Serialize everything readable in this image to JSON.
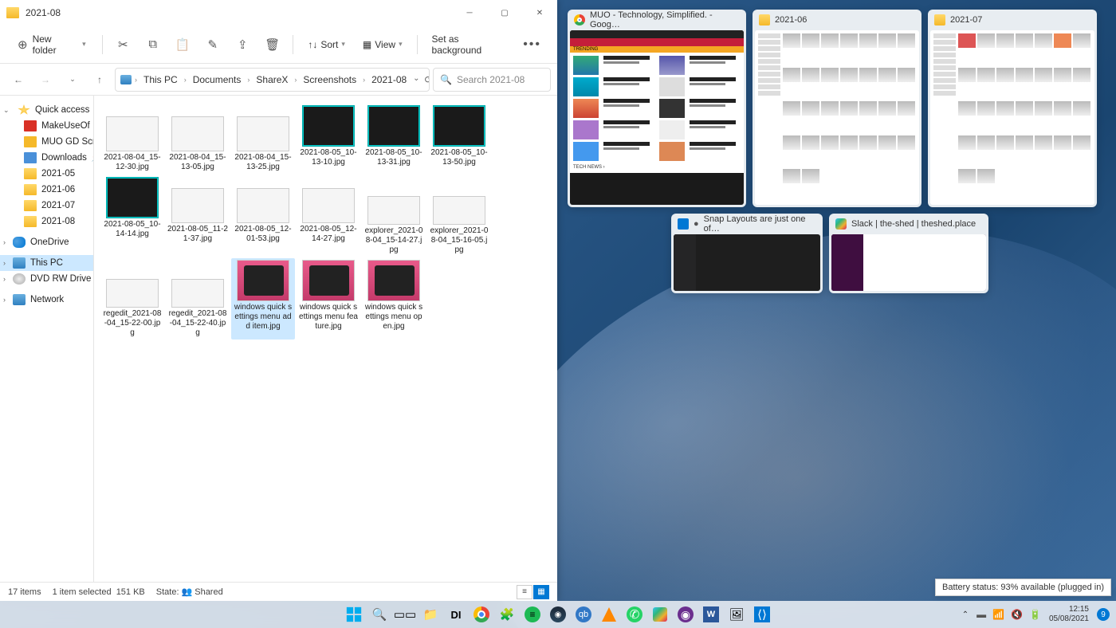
{
  "window": {
    "title": "2021-08",
    "toolbar": {
      "new_folder": "New folder",
      "sort": "Sort",
      "view": "View",
      "set_as_background": "Set as background"
    },
    "breadcrumbs": [
      "This PC",
      "Documents",
      "ShareX",
      "Screenshots",
      "2021-08"
    ],
    "search_placeholder": "Search 2021-08"
  },
  "sidebar": {
    "quick_access": "Quick access",
    "pinned": [
      {
        "label": "MakeUseOf",
        "icon": "makeuseof",
        "pinned": true
      },
      {
        "label": "MUO GD Screen",
        "icon": "muogd",
        "pinned": true
      },
      {
        "label": "Downloads",
        "icon": "dl",
        "pinned": true
      },
      {
        "label": "2021-05",
        "icon": "folder"
      },
      {
        "label": "2021-06",
        "icon": "folder"
      },
      {
        "label": "2021-07",
        "icon": "folder"
      },
      {
        "label": "2021-08",
        "icon": "folder"
      }
    ],
    "onedrive": "OneDrive",
    "this_pc": "This PC",
    "dvd": "DVD RW Drive (D:) A",
    "network": "Network"
  },
  "files": [
    {
      "name": "2021-08-04_15-12-30.jpg",
      "thumb": "light mid"
    },
    {
      "name": "2021-08-04_15-13-05.jpg",
      "thumb": "light mid"
    },
    {
      "name": "2021-08-04_15-13-25.jpg",
      "thumb": "light mid"
    },
    {
      "name": "2021-08-05_10-13-10.jpg",
      "thumb": "dark"
    },
    {
      "name": "2021-08-05_10-13-31.jpg",
      "thumb": "dark"
    },
    {
      "name": "2021-08-05_10-13-50.jpg",
      "thumb": "dark"
    },
    {
      "name": "2021-08-05_10-14-14.jpg",
      "thumb": "dark"
    },
    {
      "name": "2021-08-05_11-21-37.jpg",
      "thumb": "light mid"
    },
    {
      "name": "2021-08-05_12-01-53.jpg",
      "thumb": "light mid"
    },
    {
      "name": "2021-08-05_12-14-27.jpg",
      "thumb": "light mid"
    },
    {
      "name": "explorer_2021-08-04_15-14-27.jpg",
      "thumb": "light inset"
    },
    {
      "name": "explorer_2021-08-04_15-16-05.jpg",
      "thumb": "light inset"
    },
    {
      "name": "regedit_2021-08-04_15-22-00.jpg",
      "thumb": "light inset"
    },
    {
      "name": "regedit_2021-08-04_15-22-40.jpg",
      "thumb": "light inset"
    },
    {
      "name": "windows quick settings menu add item.jpg",
      "thumb": "pink hasqs",
      "selected": true
    },
    {
      "name": "windows quick settings menu feature.jpg",
      "thumb": "pink hasqs"
    },
    {
      "name": "windows quick settings menu open.jpg",
      "thumb": "pink hasqs"
    }
  ],
  "statusbar": {
    "items": "17 items",
    "selection": "1 item selected",
    "size": "151 KB",
    "state_label": "State:",
    "state_value": "Shared"
  },
  "snap_windows": [
    {
      "title": "MUO - Technology, Simplified. - Goog…",
      "icon": "chrome",
      "kind": "muo"
    },
    {
      "title": "2021-06",
      "icon": "folder",
      "kind": "fld"
    },
    {
      "title": "2021-07",
      "icon": "folder",
      "kind": "fld"
    },
    {
      "title": "Snap Layouts are just one of…",
      "icon": "vscode",
      "kind": "vscode"
    },
    {
      "title": "Slack | the-shed | theshed.place",
      "icon": "slack",
      "kind": "slack"
    }
  ],
  "tooltip": "Battery status: 93% available (plugged in)",
  "taskbar": {
    "icons": [
      "start",
      "search",
      "task-view",
      "explorer",
      "di",
      "chrome",
      "puzzle",
      "spotify",
      "steam",
      "qbit",
      "vlc",
      "whatsapp",
      "slack",
      "radio",
      "word",
      "devtool",
      "vscode"
    ],
    "time": "12:15",
    "date": "05/08/2021",
    "notif_count": "9"
  }
}
